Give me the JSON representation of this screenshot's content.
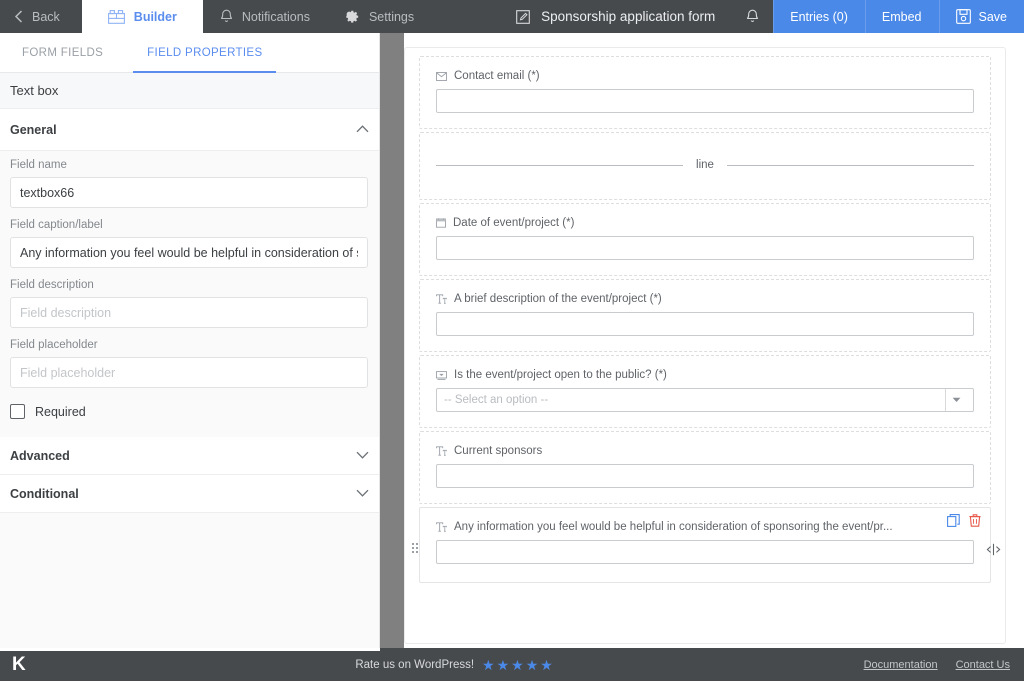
{
  "topbar": {
    "back_label": "Back",
    "builder_label": "Builder",
    "notifications_label": "Notifications",
    "settings_label": "Settings",
    "form_title": "Sponsorship application form",
    "entries_label": "Entries (0)",
    "embed_label": "Embed",
    "save_label": "Save",
    "accent_blue": "#4a89e8",
    "bar_bg": "#474a4d"
  },
  "sidebar": {
    "tabs": [
      {
        "label": "FORM FIELDS",
        "active": false
      },
      {
        "label": "FIELD PROPERTIES",
        "active": true
      }
    ],
    "panel_title": "Text box",
    "general": {
      "title": "General",
      "fields": [
        {
          "label": "Field name",
          "value": "textbox66",
          "placeholder": ""
        },
        {
          "label": "Field caption/label",
          "value": "Any information you feel would be helpful in consideration of sponsori",
          "placeholder": ""
        },
        {
          "label": "Field description",
          "value": "",
          "placeholder": "Field description"
        },
        {
          "label": "Field placeholder",
          "value": "",
          "placeholder": "Field placeholder"
        }
      ],
      "required_label": "Required",
      "required_checked": false
    },
    "sections": [
      {
        "label": "Advanced",
        "expanded": false
      },
      {
        "label": "Conditional",
        "expanded": false
      }
    ]
  },
  "canvas": {
    "fields": [
      {
        "type": "text",
        "icon": "envelope-icon",
        "label": "Contact email (*)",
        "value": ""
      },
      {
        "type": "line",
        "label": "line"
      },
      {
        "type": "text",
        "icon": "calendar-icon",
        "label": "Date of event/project (*)",
        "value": ""
      },
      {
        "type": "text",
        "icon": "text-format-icon",
        "label": "A brief description of the event/project (*)",
        "value": ""
      },
      {
        "type": "select",
        "icon": "dropdown-icon",
        "label": "Is the event/project open to the public? (*)",
        "value": "-- Select an option --"
      },
      {
        "type": "text",
        "icon": "text-format-icon",
        "label": "Current sponsors",
        "value": ""
      },
      {
        "type": "text",
        "icon": "text-format-icon",
        "label": "Any information you feel would be helpful in consideration of sponsoring the event/pr...",
        "value": "",
        "selected": true,
        "duplicate_color": "#4a89e8",
        "delete_color": "#e8584a"
      }
    ]
  },
  "footer": {
    "logo": "K",
    "rate_text": "Rate us on WordPress!",
    "star_count": 5,
    "star_color": "#4a89e8",
    "links": [
      "Documentation",
      "Contact Us"
    ]
  }
}
